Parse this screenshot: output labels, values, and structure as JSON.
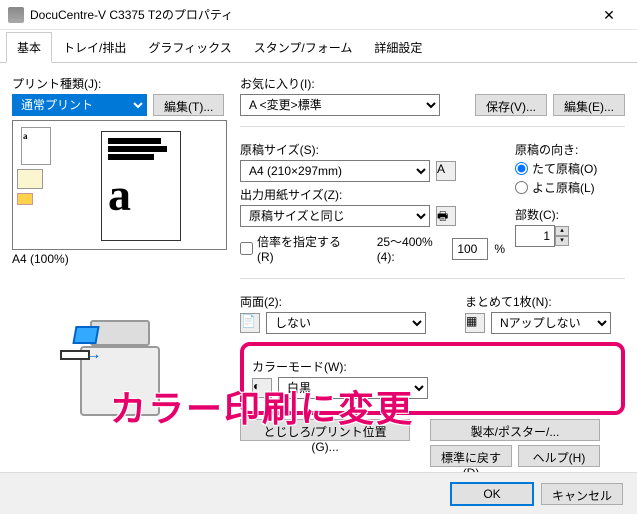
{
  "window": {
    "title": "DocuCentre-V C3375 T2のプロパティ",
    "close": "✕"
  },
  "tabs": {
    "basic": "基本",
    "tray": "トレイ/排出",
    "graphics": "グラフィックス",
    "stamp": "スタンプ/フォーム",
    "advanced": "詳細設定"
  },
  "left": {
    "print_type_label": "プリント種類(J):",
    "print_type_value": "通常プリント",
    "edit_btn": "編集(T)...",
    "preview_caption": "A4 (100%)"
  },
  "fav": {
    "label": "お気に入り(I):",
    "value": "A <変更>標準",
    "save": "保存(V)...",
    "edit": "編集(E)..."
  },
  "orig": {
    "size_label": "原稿サイズ(S):",
    "size_value": "A4 (210×297mm)",
    "out_label": "出力用紙サイズ(Z):",
    "out_value": "原稿サイズと同じ",
    "scale_check": "倍率を指定する(R)",
    "scale_hint": "25～400%(4):",
    "scale_value": "100",
    "pct": "%"
  },
  "orient": {
    "label": "原稿の向き:",
    "portrait": "たて原稿(O)",
    "landscape": "よこ原稿(L)"
  },
  "copies": {
    "label": "部数(C):",
    "value": "1"
  },
  "duplex": {
    "label": "両面(2):",
    "value": "しない"
  },
  "nup": {
    "label": "まとめて1枚(N):",
    "value": "Nアップしない"
  },
  "color": {
    "label": "カラーモード(W):",
    "value": "白黒"
  },
  "btns": {
    "bind": "とじしろ/プリント位置(G)...",
    "book": "製本/ポスター/...",
    "defaults": "標準に戻す(D)",
    "help": "ヘルプ(H)"
  },
  "footer": {
    "ok": "OK",
    "cancel": "キャンセル"
  },
  "overlay": "カラー印刷に変更"
}
